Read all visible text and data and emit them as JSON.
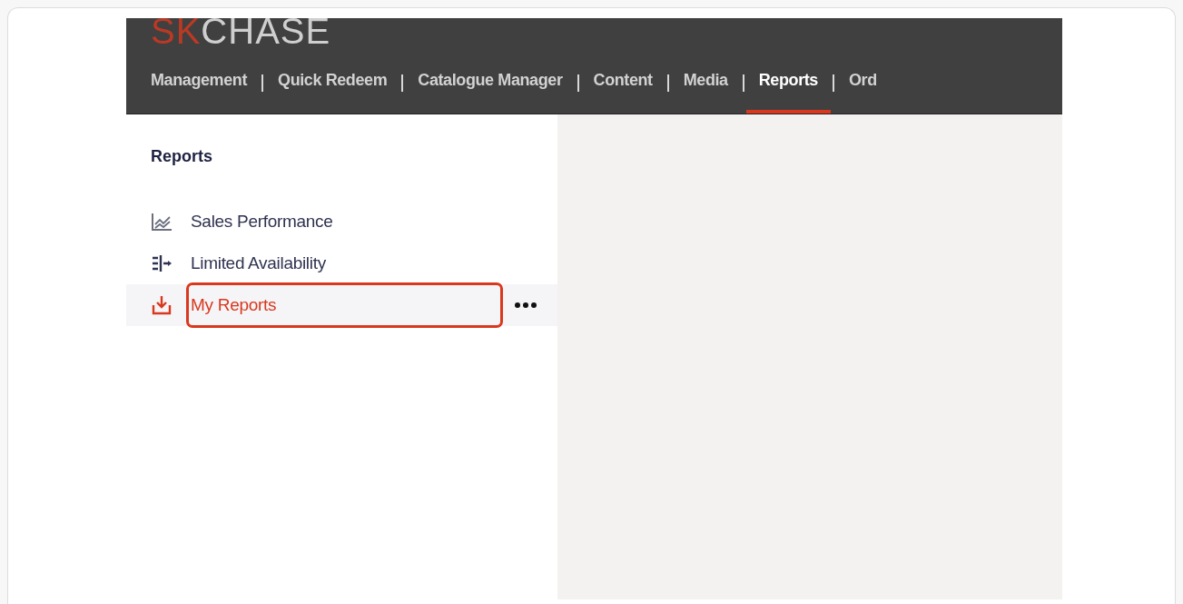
{
  "logo": {
    "accent": "SK",
    "rest": "CHASE"
  },
  "nav": [
    {
      "label": "Management",
      "selected": false
    },
    {
      "label": "Quick Redeem",
      "selected": false
    },
    {
      "label": "Catalogue Manager",
      "selected": false
    },
    {
      "label": "Content",
      "selected": false
    },
    {
      "label": "Media",
      "selected": false
    },
    {
      "label": "Reports",
      "selected": true
    },
    {
      "label": "Ord",
      "selected": false
    }
  ],
  "sidebar": {
    "title": "Reports",
    "items": [
      {
        "label": "Sales Performance",
        "selected": false,
        "highlighted": false
      },
      {
        "label": "Limited Availability",
        "selected": false,
        "highlighted": false
      },
      {
        "label": "My Reports",
        "selected": true,
        "highlighted": true
      }
    ]
  }
}
